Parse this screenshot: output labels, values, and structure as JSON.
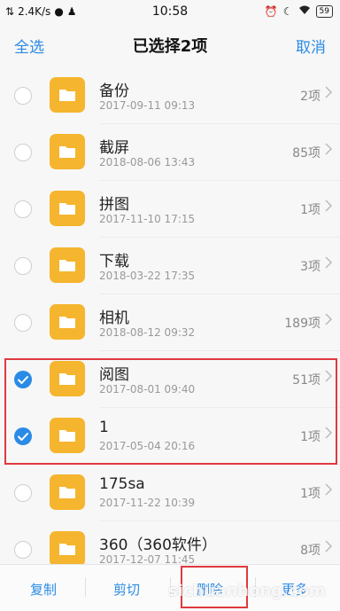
{
  "status_bar": {
    "speed": "2.4K/s",
    "time": "10:58",
    "battery": "59"
  },
  "header": {
    "select_all": "全选",
    "title": "已选择2项",
    "cancel": "取消"
  },
  "rows": [
    {
      "name": "备份",
      "date": "2017-09-11 09:13",
      "count": "2项",
      "checked": false
    },
    {
      "name": "截屏",
      "date": "2018-08-06 13:43",
      "count": "85项",
      "checked": false
    },
    {
      "name": "拼图",
      "date": "2017-11-10 17:15",
      "count": "1项",
      "checked": false
    },
    {
      "name": "下载",
      "date": "2018-03-22 17:35",
      "count": "3项",
      "checked": false
    },
    {
      "name": "相机",
      "date": "2018-08-12 09:32",
      "count": "189项",
      "checked": false
    },
    {
      "name": "阅图",
      "date": "2017-08-01 09:40",
      "count": "51项",
      "checked": true
    },
    {
      "name": "1",
      "date": "2017-05-04 20:16",
      "count": "1项",
      "checked": true
    },
    {
      "name": "175sa",
      "date": "2017-11-22 10:39",
      "count": "1项",
      "checked": false
    },
    {
      "name": "360（360软件）",
      "date": "2017-12-07 11:45",
      "count": "8项",
      "checked": false
    }
  ],
  "bottom_bar": {
    "copy": "复制",
    "cut": "剪切",
    "delete": "删除",
    "more": "更多"
  },
  "watermark": "sichuanhong.com",
  "colors": {
    "accent": "#2a8be6",
    "folder": "#f5b52e",
    "highlight": "#e0393e"
  }
}
